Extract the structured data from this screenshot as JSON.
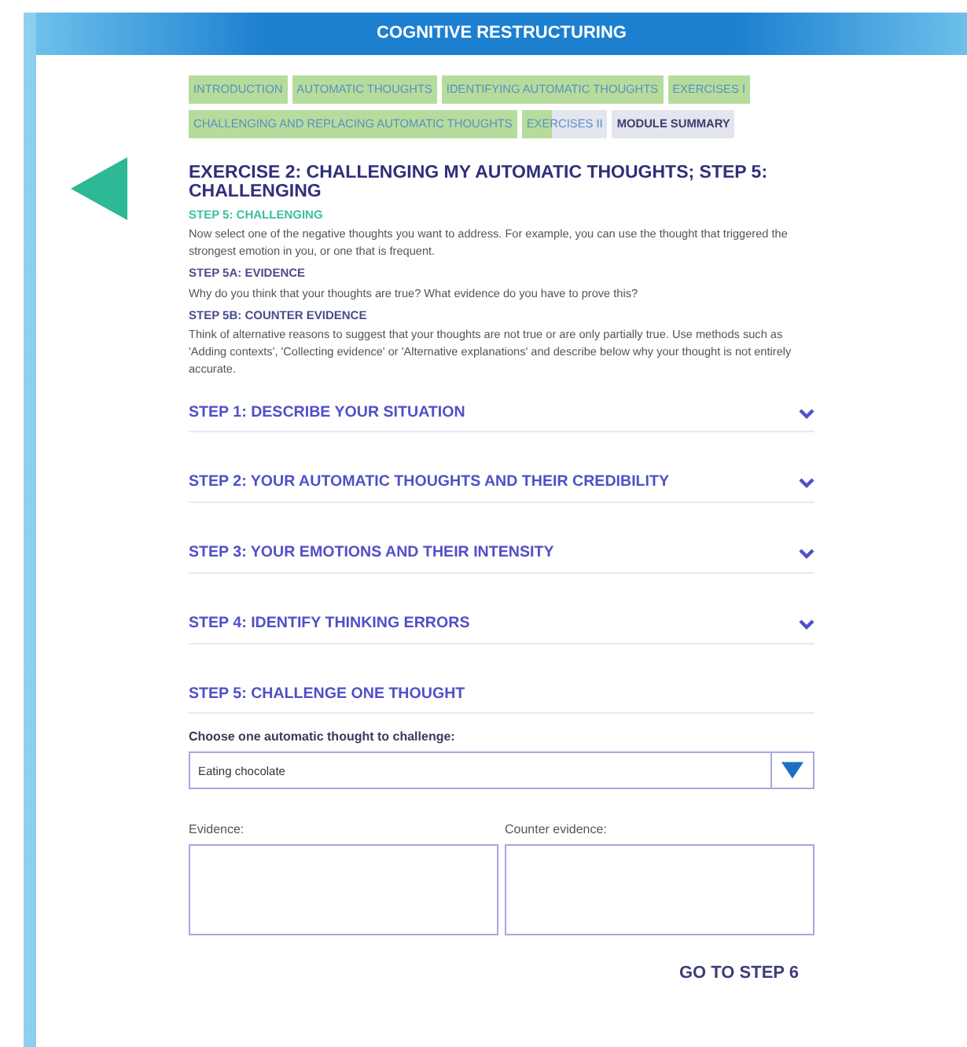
{
  "header": {
    "title": "COGNITIVE RESTRUCTURING"
  },
  "nav": [
    {
      "label": "INTRODUCTION",
      "level": 1
    },
    {
      "label": "AUTOMATIC THOUGHTS",
      "level": 1
    },
    {
      "label": "IDENTIFYING AUTOMATIC THOUGHTS",
      "level": 1
    },
    {
      "label": "EXERCISES I",
      "level": 1
    },
    {
      "label": "CHALLENGING AND REPLACING AUTOMATIC THOUGHTS",
      "level": 1
    },
    {
      "label": "EXERCISES II",
      "level": 0.35
    },
    {
      "label": "MODULE SUMMARY",
      "level": 0
    }
  ],
  "exercise": {
    "title": "EXERCISE 2: CHALLENGING MY AUTOMATIC THOUGHTS; STEP 5: CHALLENGING",
    "blocks": [
      {
        "kind": "highlight",
        "heading": "STEP 5: CHALLENGING",
        "text": "Now select one of the negative thoughts you want to address. For example, you can use the thought that triggered the strongest emotion in you, or one that is frequent."
      },
      {
        "kind": "plain",
        "heading": "STEP 5A: EVIDENCE",
        "text": "Why do you think that your thoughts are true? What evidence do you have to prove this?"
      },
      {
        "kind": "plain",
        "heading": "STEP 5B: COUNTER EVIDENCE",
        "text": "Think of alternative reasons to suggest that your thoughts are not true or are only partially true. Use methods such as 'Adding contexts', 'Collecting evidence' or 'Alternative explanations' and describe below why your thought is not entirely accurate."
      }
    ]
  },
  "steps": [
    {
      "title": "STEP 1: DESCRIBE YOUR SITUATION",
      "expanded": false
    },
    {
      "title": "STEP 2: YOUR AUTOMATIC THOUGHTS AND THEIR CREDIBILITY",
      "expanded": false
    },
    {
      "title": "STEP 3: YOUR EMOTIONS AND THEIR INTENSITY",
      "expanded": false
    },
    {
      "title": "STEP 4: IDENTIFY THINKING ERRORS",
      "expanded": false
    },
    {
      "title": "STEP 5: CHALLENGE ONE THOUGHT",
      "expanded": true
    }
  ],
  "challenge": {
    "select_label": "Choose one automatic thought to challenge:",
    "select_value": "Eating chocolate",
    "evidence_label": "Evidence:",
    "counter_label": "Counter evidence:"
  },
  "next_button": "GO TO STEP 6"
}
